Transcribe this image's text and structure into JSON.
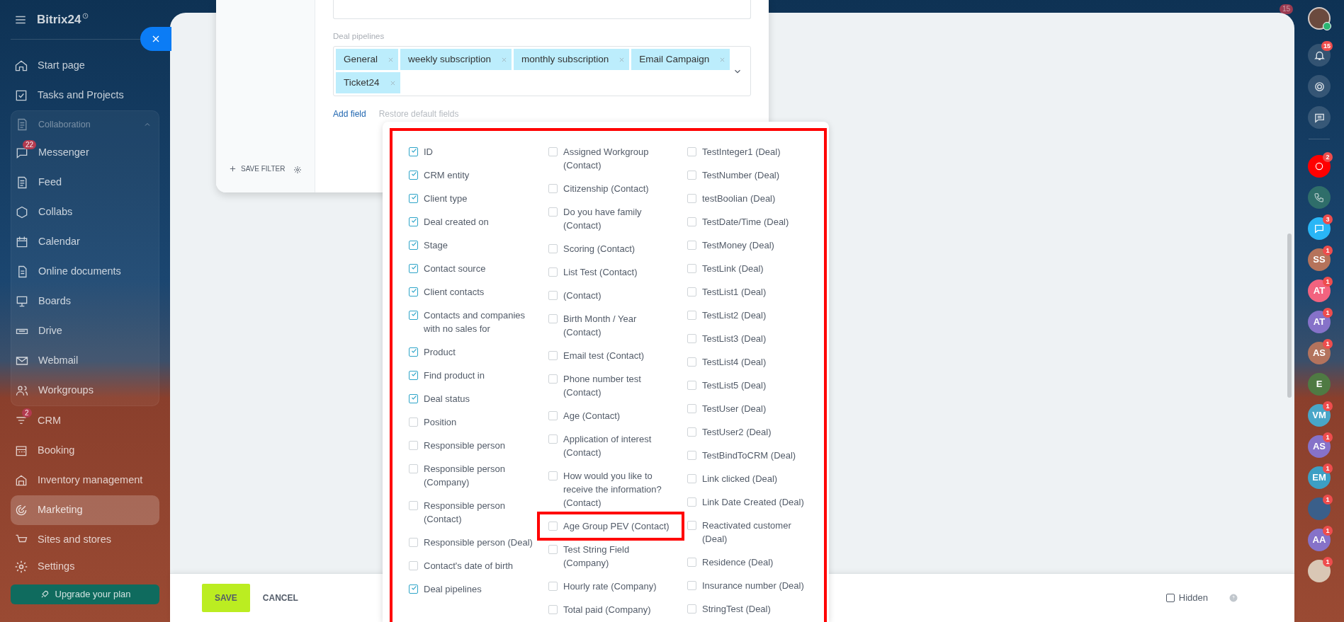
{
  "sidebar": {
    "logo": "Bitrix24",
    "items": [
      {
        "label": "Start page",
        "selected": false
      },
      {
        "label": "Tasks and Projects",
        "selected": false
      }
    ],
    "group": {
      "label": "Collaboration",
      "expanded": true,
      "items": [
        {
          "label": "Messenger",
          "badge": "22",
          "selected": false
        },
        {
          "label": "Feed",
          "selected": false
        },
        {
          "label": "Collabs",
          "selected": false
        },
        {
          "label": "Calendar",
          "selected": false
        },
        {
          "label": "Online documents",
          "selected": false
        },
        {
          "label": "Boards",
          "selected": false
        },
        {
          "label": "Drive",
          "selected": false
        },
        {
          "label": "Webmail",
          "selected": false
        },
        {
          "label": "Workgroups",
          "selected": false
        }
      ]
    },
    "items_after": [
      {
        "label": "CRM",
        "badge": "2",
        "selected": false
      },
      {
        "label": "Booking",
        "selected": false
      },
      {
        "label": "Inventory management",
        "selected": false
      },
      {
        "label": "Marketing",
        "selected": true
      },
      {
        "label": "Sites and stores",
        "selected": false
      }
    ],
    "settings": "Settings",
    "upgrade_button": "Upgrade your plan"
  },
  "top_bar": {
    "badge": "15"
  },
  "filter": {
    "save_filter": "SAVE FILTER",
    "field_label": "Deal pipelines",
    "tags": [
      "General",
      "weekly subscription",
      "monthly subscription",
      "Email Campaign",
      "Ticket24"
    ],
    "add_field": "Add field",
    "restore_defaults": "Restore default fields"
  },
  "field_list": {
    "columns": [
      [
        {
          "label": "ID",
          "checked": true,
          "highlighted": false
        },
        {
          "label": "CRM entity",
          "checked": true,
          "highlighted": false
        },
        {
          "label": "Client type",
          "checked": true,
          "highlighted": false
        },
        {
          "label": "Deal created on",
          "checked": true,
          "highlighted": false
        },
        {
          "label": "Stage",
          "checked": true,
          "highlighted": false
        },
        {
          "label": "Contact source",
          "checked": true,
          "highlighted": false
        },
        {
          "label": "Client contacts",
          "checked": true,
          "highlighted": false
        },
        {
          "label": "Contacts and companies with no sales for",
          "checked": true,
          "highlighted": false
        },
        {
          "label": "Product",
          "checked": true,
          "highlighted": false
        },
        {
          "label": "Find product in",
          "checked": true,
          "highlighted": false
        },
        {
          "label": "Deal status",
          "checked": true,
          "highlighted": false
        },
        {
          "label": "Position",
          "checked": false,
          "highlighted": false
        },
        {
          "label": "Responsible person",
          "checked": false,
          "highlighted": false
        },
        {
          "label": "Responsible person (Company)",
          "checked": false,
          "highlighted": false
        },
        {
          "label": "Responsible person (Contact)",
          "checked": false,
          "highlighted": false
        },
        {
          "label": "Responsible person (Deal)",
          "checked": false,
          "highlighted": false
        },
        {
          "label": "Contact's date of birth",
          "checked": false,
          "highlighted": false
        },
        {
          "label": "Deal pipelines",
          "checked": true,
          "highlighted": false
        }
      ],
      [
        {
          "label": "Assigned Workgroup (Contact)",
          "checked": false,
          "highlighted": false
        },
        {
          "label": "Citizenship (Contact)",
          "checked": false,
          "highlighted": false
        },
        {
          "label": "Do you have family (Contact)",
          "checked": false,
          "highlighted": false
        },
        {
          "label": "Scoring (Contact)",
          "checked": false,
          "highlighted": false
        },
        {
          "label": "List Test (Contact)",
          "checked": false,
          "highlighted": false
        },
        {
          "label": "(Contact)",
          "checked": false,
          "highlighted": false
        },
        {
          "label": "Birth Month / Year (Contact)",
          "checked": false,
          "highlighted": false
        },
        {
          "label": "Email test (Contact)",
          "checked": false,
          "highlighted": false
        },
        {
          "label": "Phone number test (Contact)",
          "checked": false,
          "highlighted": false
        },
        {
          "label": "Age (Contact)",
          "checked": false,
          "highlighted": false
        },
        {
          "label": "Application of interest (Contact)",
          "checked": false,
          "highlighted": false
        },
        {
          "label": "How would you like to receive the information? (Contact)",
          "checked": false,
          "highlighted": false
        },
        {
          "label": "Age Group PEV (Contact)",
          "checked": false,
          "highlighted": true
        },
        {
          "label": "Test String Field (Company)",
          "checked": false,
          "highlighted": false
        },
        {
          "label": "Hourly rate (Company)",
          "checked": false,
          "highlighted": false
        },
        {
          "label": "Total paid (Company)",
          "checked": false,
          "highlighted": false
        }
      ],
      [
        {
          "label": "TestInteger1 (Deal)",
          "checked": false,
          "highlighted": false
        },
        {
          "label": "TestNumber (Deal)",
          "checked": false,
          "highlighted": false
        },
        {
          "label": "testBoolian (Deal)",
          "checked": false,
          "highlighted": false
        },
        {
          "label": "TestDate/Time (Deal)",
          "checked": false,
          "highlighted": false
        },
        {
          "label": "TestMoney (Deal)",
          "checked": false,
          "highlighted": false
        },
        {
          "label": "TestLink (Deal)",
          "checked": false,
          "highlighted": false
        },
        {
          "label": "TestList1 (Deal)",
          "checked": false,
          "highlighted": false
        },
        {
          "label": "TestList2 (Deal)",
          "checked": false,
          "highlighted": false
        },
        {
          "label": "TestList3 (Deal)",
          "checked": false,
          "highlighted": false
        },
        {
          "label": "TestList4 (Deal)",
          "checked": false,
          "highlighted": false
        },
        {
          "label": "TestList5 (Deal)",
          "checked": false,
          "highlighted": false
        },
        {
          "label": "TestUser (Deal)",
          "checked": false,
          "highlighted": false
        },
        {
          "label": "TestUser2 (Deal)",
          "checked": false,
          "highlighted": false
        },
        {
          "label": "TestBindToCRM (Deal)",
          "checked": false,
          "highlighted": false
        },
        {
          "label": "Link clicked (Deal)",
          "checked": false,
          "highlighted": false
        },
        {
          "label": "Link Date Created (Deal)",
          "checked": false,
          "highlighted": false
        },
        {
          "label": "Reactivated customer (Deal)",
          "checked": false,
          "highlighted": false
        },
        {
          "label": "Residence (Deal)",
          "checked": false,
          "highlighted": false
        },
        {
          "label": "Insurance number (Deal)",
          "checked": false,
          "highlighted": false
        },
        {
          "label": "StringTest (Deal)",
          "checked": false,
          "highlighted": false
        }
      ]
    ]
  },
  "footer": {
    "save": "SAVE",
    "cancel": "CANCEL",
    "hidden": {
      "label": "Hidden",
      "checked": false
    }
  },
  "right_rail": {
    "notifications_badge": "15",
    "contacts": [
      {
        "kind": "app",
        "badge": "2",
        "color": "#ff0000"
      },
      {
        "kind": "phone",
        "color": "#2f6e6a"
      },
      {
        "kind": "chat",
        "badge": "3",
        "color": "#29b6f6"
      },
      {
        "kind": "initials",
        "initials": "SS",
        "badge": "1",
        "color": "#b5735b"
      },
      {
        "kind": "initials",
        "initials": "AT",
        "badge": "1",
        "color": "#f2637f"
      },
      {
        "kind": "initials",
        "initials": "AT",
        "badge": "1",
        "color": "#8672c9"
      },
      {
        "kind": "initials",
        "initials": "AS",
        "badge": "1",
        "color": "#b3735d"
      },
      {
        "kind": "initials",
        "initials": "E",
        "color": "#4f7a43"
      },
      {
        "kind": "initials",
        "initials": "VM",
        "badge": "1",
        "color": "#48a6c8"
      },
      {
        "kind": "initials",
        "initials": "AS",
        "badge": "1",
        "color": "#8672c9"
      },
      {
        "kind": "initials",
        "initials": "EM",
        "badge": "1",
        "color": "#3d9fc4"
      },
      {
        "kind": "photo",
        "badge": "1",
        "color": "#3a5f8a"
      },
      {
        "kind": "initials",
        "initials": "AA",
        "badge": "1",
        "color": "#8672c9"
      },
      {
        "kind": "photo",
        "badge": "1",
        "color": "#d9c7b5"
      }
    ]
  }
}
